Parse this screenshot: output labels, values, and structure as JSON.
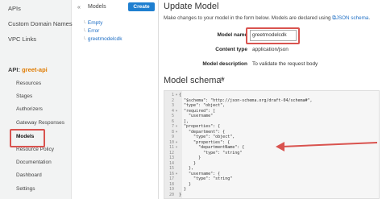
{
  "sidebar": {
    "top_items": [
      "APIs",
      "Custom Domain Names",
      "VPC Links"
    ],
    "api_label": "API:",
    "api_name": "greet-api",
    "sub_items": [
      "Resources",
      "Stages",
      "Authorizers",
      "Gateway Responses",
      "Models",
      "Resource Policy",
      "Documentation",
      "Dashboard",
      "Settings"
    ],
    "active_item": "Models"
  },
  "models_panel": {
    "title": "Models",
    "create_label": "Create",
    "items": [
      "Empty",
      "Error",
      "greetmodelcdk"
    ]
  },
  "main": {
    "title": "Update Model",
    "description": "Make changes to your model in the form below. Models are declared using",
    "description_link": "JSON schema",
    "description_end": ".",
    "fields": {
      "model_name_label": "Model name",
      "model_name_value": "greetmodelcdk",
      "content_type_label": "Content type",
      "content_type_value": "application/json",
      "model_description_label": "Model description",
      "model_description_value": "To validate the request body"
    },
    "schema_title": "Model schema*"
  },
  "editor": {
    "lines": [
      "{",
      "  \"$schema\": \"http://json-schema.org/draft-04/schema#\",",
      "  \"type\": \"object\",",
      "  \"required\": [",
      "    \"username\"",
      "  ],",
      "  \"properties\": {",
      "    \"department\": {",
      "      \"type\": \"object\",",
      "      \"properties\": {",
      "        \"departmentName\": {",
      "          \"type\": \"string\"",
      "        }",
      "      }",
      "    },",
      "    \"username\": {",
      "      \"type\": \"string\"",
      "    }",
      "  }",
      "}"
    ],
    "fold_lines": [
      1,
      4,
      7,
      8,
      10,
      11,
      16
    ]
  },
  "colors": {
    "accent": "#1f7fd0",
    "api_name": "#e07b00",
    "highlight": "#d9534f"
  }
}
